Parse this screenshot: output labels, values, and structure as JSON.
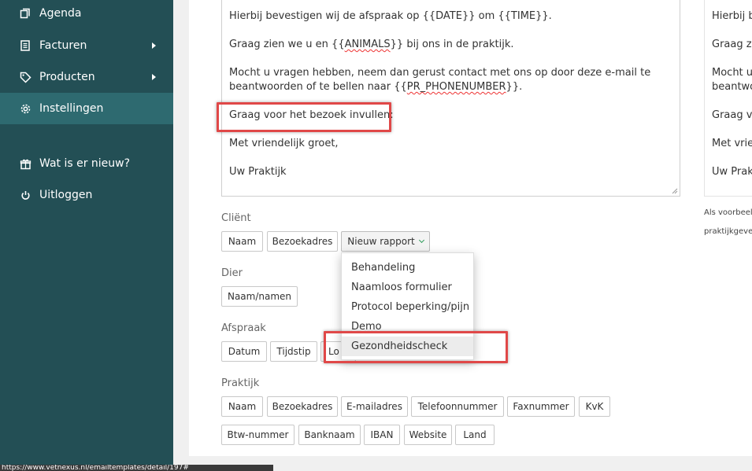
{
  "sidebar": {
    "items": [
      {
        "label": "Agenda",
        "icon": "copy-icon"
      },
      {
        "label": "Facturen",
        "icon": "invoice-icon"
      },
      {
        "label": "Producten",
        "icon": "tag-icon"
      },
      {
        "label": "Instellingen",
        "icon": "gear-icon"
      },
      {
        "label": "Wat is er nieuw?",
        "icon": "gift-icon"
      },
      {
        "label": "Uitloggen",
        "icon": "power-icon"
      }
    ],
    "colors": {
      "background": "#234f55",
      "active": "#2e6a70"
    }
  },
  "editor": {
    "line1": "Hierbij bevestigen wij de afspraak op {{DATE}} om {{TIME}}.",
    "line2_a": "Graag zien we u en {{",
    "line2_b": "ANIMALS",
    "line2_c": "}} bij ons in de praktijk.",
    "line3": "Mocht u vragen hebben, neem dan gerust contact met ons op door deze e-mail te",
    "line4_a": "beantwoorden of te bellen naar {{",
    "line4_b": "PR_PHONENUMBER",
    "line4_c": "}}.",
    "line5": "Graag voor het bezoek invullen:",
    "line6": "Met vriendelijk groet,",
    "line7": "Uw Praktijk"
  },
  "preview": {
    "lines": [
      "Hierbij beve",
      "Graag zien w",
      "Mocht u vrag",
      "beantwoord",
      "Graag voor",
      "Met vriende",
      "Uw Praktijk"
    ],
    "note_line1": "Als voorbeeld w",
    "note_line2": "praktijkgeven"
  },
  "sections": {
    "client": {
      "label": "Cliënt",
      "chips": [
        "Naam",
        "Bezoekadres",
        "Nieuw rapport"
      ]
    },
    "dier": {
      "label": "Dier",
      "chips": [
        "Naam/namen"
      ]
    },
    "afspraak": {
      "label": "Afspraak",
      "chips": [
        "Datum",
        "Tijdstip",
        "Lo"
      ]
    },
    "praktijk": {
      "label": "Praktijk",
      "chips_row1": [
        "Naam",
        "Bezoekadres",
        "E-mailadres",
        "Telefoonnummer",
        "Faxnummer",
        "KvK"
      ],
      "chips_row2": [
        "Btw-nummer",
        "Banknaam",
        "IBAN",
        "Website",
        "Land"
      ]
    }
  },
  "dropdown": {
    "items": [
      "Behandeling",
      "Naamloos formulier",
      "Protocol beperking/pijn",
      "Demo",
      "Gezondheidscheck"
    ],
    "hovered": "Gezondheidscheck"
  },
  "statusbar": {
    "url": "https://www.vetnexus.nl/emailtemplates/detail/197#"
  },
  "colors": {
    "highlight": "#e04848",
    "chevron": "#2e9c5a"
  }
}
